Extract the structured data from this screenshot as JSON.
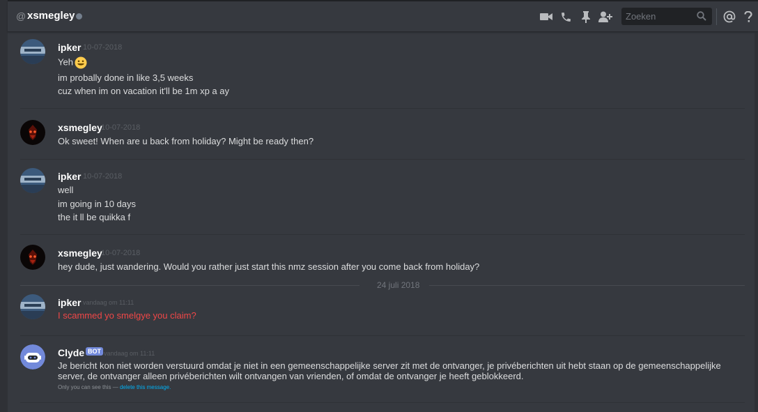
{
  "header": {
    "at_symbol": "@",
    "channel_name": "xsmegley",
    "search_placeholder": "Zoeken",
    "icons": [
      "video-call-icon",
      "voice-call-icon",
      "pin-icon",
      "add-friend-icon",
      "search-icon",
      "mention-icon",
      "help-icon"
    ]
  },
  "messages": [
    {
      "author": "ipker",
      "timestamp": "10-07-2018",
      "lines": [
        "Yeh",
        "im probally done in like 3,5 weeks",
        "cuz when im on vacation it'll be 1m xp a ay"
      ]
    },
    {
      "author": "xsmegley",
      "timestamp": "10-07-2018",
      "lines": [
        "Ok sweet! When are u back from holiday? Might be ready then?"
      ]
    },
    {
      "author": "ipker",
      "timestamp": "10-07-2018",
      "lines": [
        "well",
        "im going in 10 days",
        "the it ll be quikka f"
      ]
    },
    {
      "author": "xsmegley",
      "timestamp": "10-07-2018",
      "lines": [
        "hey dude, just wandering. Would you rather just start this nmz session after you come back from holiday?"
      ]
    }
  ],
  "date_divider": "24 juli 2018",
  "failed_message": {
    "author": "ipker",
    "timestamp": "vandaag om 11:11",
    "text": "I scammed yo smelgye you claim?"
  },
  "clyde": {
    "author": "Clyde",
    "bot_tag": "BOT",
    "timestamp": "vandaag om 11:11",
    "text": "Je bericht kon niet worden verstuurd omdat je niet in een gemeenschappelijke server zit met de ontvanger, je privéberichten uit hebt staan op de gemeenschappelijke server, de ontvanger alleen privéberichten wilt ontvangen van vrienden, of omdat de ontvanger je heeft geblokkeerd.",
    "ephemeral_prefix": "Only you can see this — ",
    "delete_link": "delete this message."
  },
  "colors": {
    "background": "#36393f",
    "username": "#ffffff",
    "failed_text": "#f04747",
    "bot_tag": "#7289da",
    "link": "#00b0f4"
  }
}
